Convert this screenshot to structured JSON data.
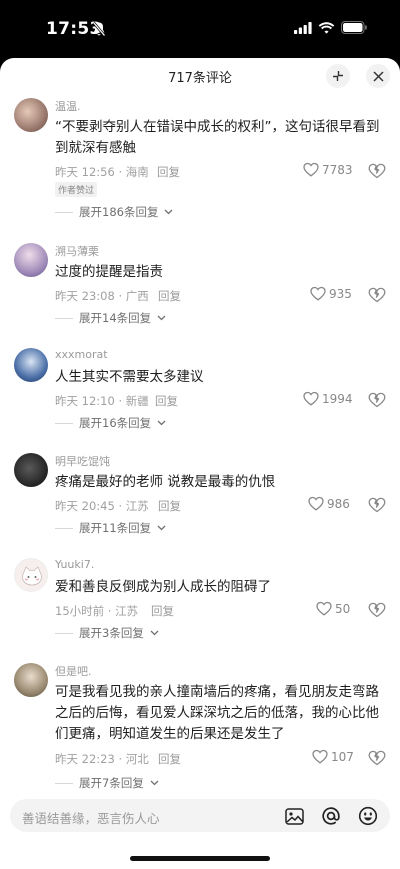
{
  "status_bar": {
    "time": "17:53"
  },
  "sheet": {
    "title": "717条评论",
    "input_placeholder": "善语结善缘，恶言伤人心"
  },
  "comments": [
    {
      "username": "温温.",
      "lines": [
        "“不要剥夺别人在错误中成长的权利”，这句话很早看到",
        "到就深有感触"
      ],
      "meta": "昨天 12:56 · 海南",
      "reply": "回复",
      "likes": "7783",
      "badge": "作者赞过",
      "expand": "展开186条回复"
    },
    {
      "username": "溯马薄栗",
      "lines": [
        "过度的提醒是指责"
      ],
      "meta": "昨天 23:08 · 广西",
      "reply": "回复",
      "likes": "935",
      "expand": "展开14条回复"
    },
    {
      "username": "xxxmorat",
      "lines": [
        "人生其实不需要太多建议"
      ],
      "meta": "昨天 12:10 · 新疆",
      "reply": "回复",
      "likes": "1994",
      "expand": "展开16条回复"
    },
    {
      "username": "明早吃馄饨",
      "lines": [
        "疼痛是最好的老师 说教是最毒的仇恨"
      ],
      "meta": "昨天 20:45 · 江苏",
      "reply": "回复",
      "likes": "986",
      "expand": "展开11条回复"
    },
    {
      "username": "Yuuki7.",
      "lines": [
        "爱和善良反倒成为别人成长的阻碍了"
      ],
      "meta": "15小时前 · 江苏",
      "reply": "回复",
      "likes": "50",
      "expand": "展开3条回复"
    },
    {
      "username": "但是吧.",
      "lines": [
        "可是我看见我的亲人撞南墙后的疼痛，看见朋友走弯路",
        "之后的后悔，看见爱人踩深坑之后的低落，我的心比他",
        "们更痛，明知道发生的后果还是发生了"
      ],
      "meta": "昨天 22:23 · 河北",
      "reply": "回复",
      "likes": "107",
      "expand": "展开7条回复"
    }
  ]
}
